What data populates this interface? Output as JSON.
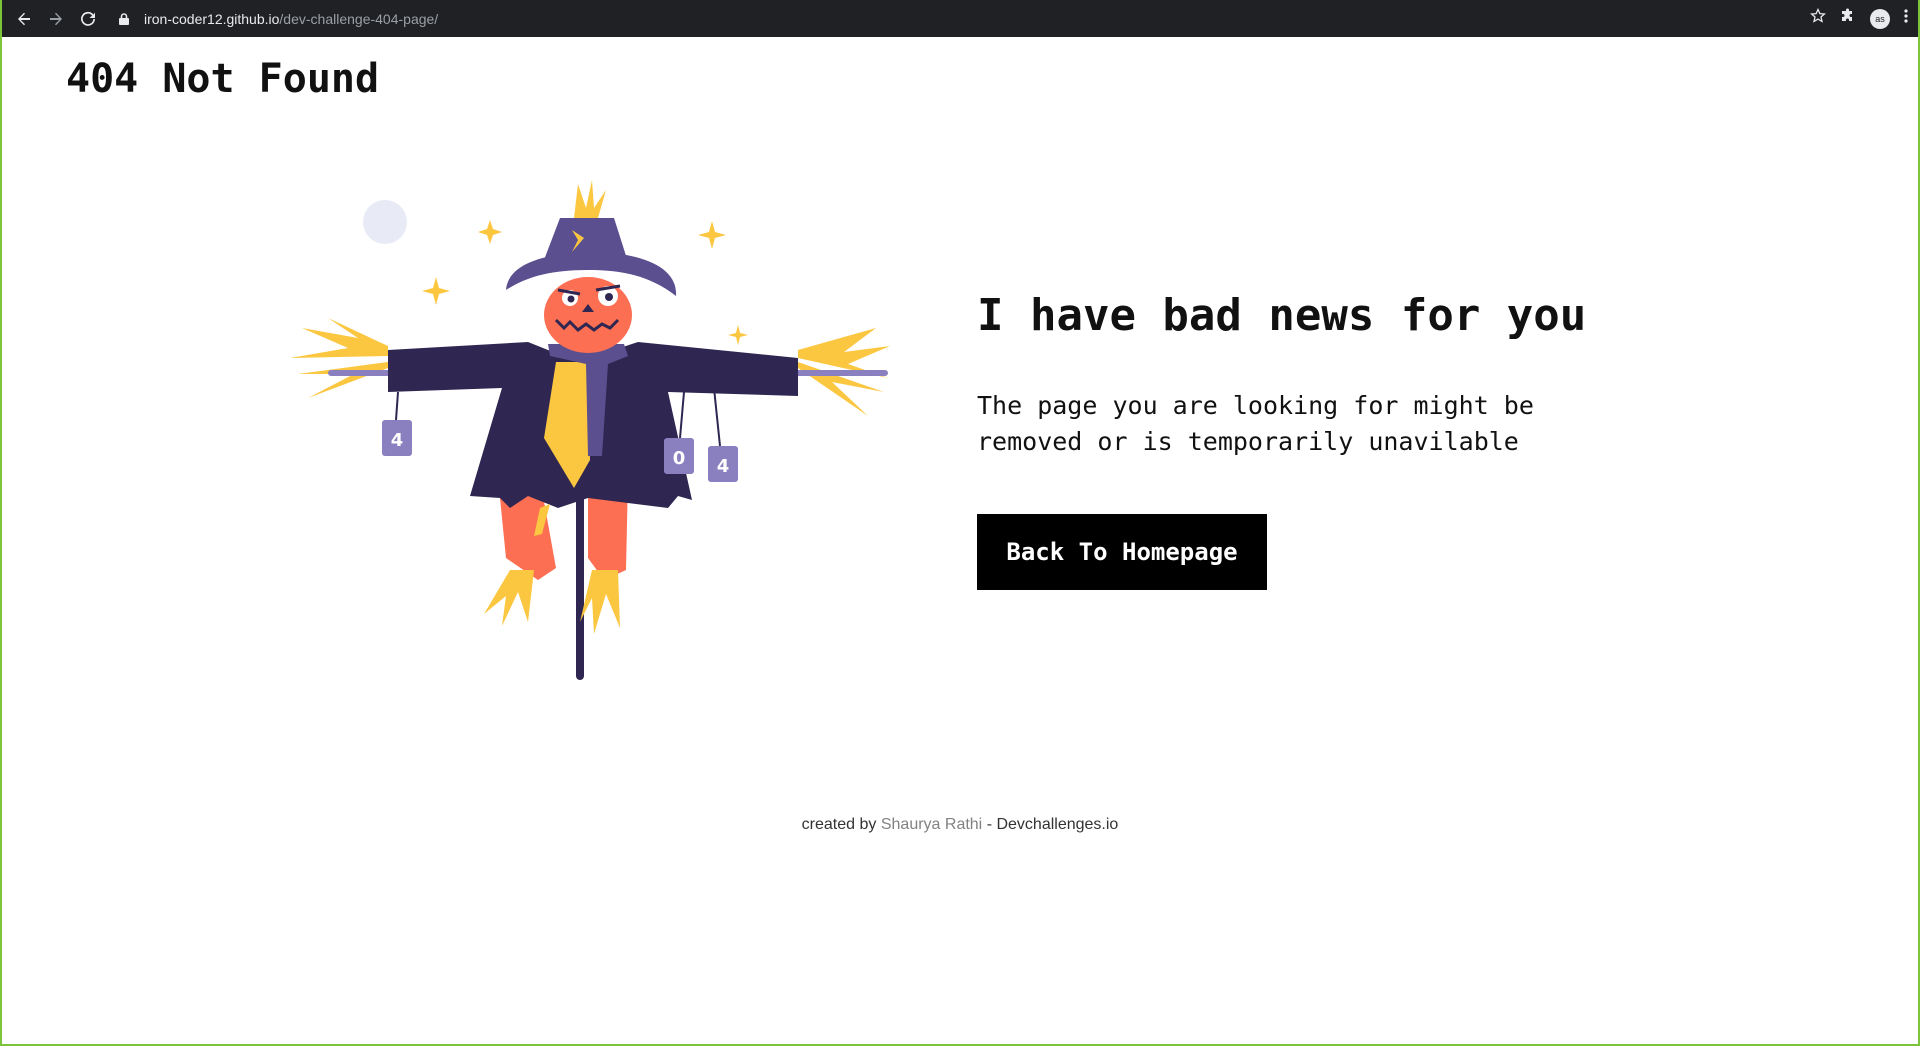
{
  "browser": {
    "url_host": "iron-coder12.github.io",
    "url_path": "/dev-challenge-404-page/",
    "avatar_text": "as"
  },
  "page": {
    "title": "404 Not Found",
    "headline": "I have bad news for you",
    "message_line1": "The page you are looking for might be",
    "message_line2": "removed or is temporarily unavilable",
    "button_label": "Back To Homepage"
  },
  "illustration": {
    "can_labels": [
      "4",
      "0",
      "4"
    ]
  },
  "footer": {
    "prefix": "created by",
    "author": "Shaurya Rathi",
    "separator": "-",
    "site": "Devchallenges.io"
  },
  "colors": {
    "accent": "#000000",
    "border": "#7cc43a",
    "scarecrow_coat": "#2f2651",
    "scarecrow_hat": "#5b4f8f",
    "scarecrow_face": "#fc6f52",
    "straw": "#fcc740",
    "moon": "#e8eaf6"
  }
}
